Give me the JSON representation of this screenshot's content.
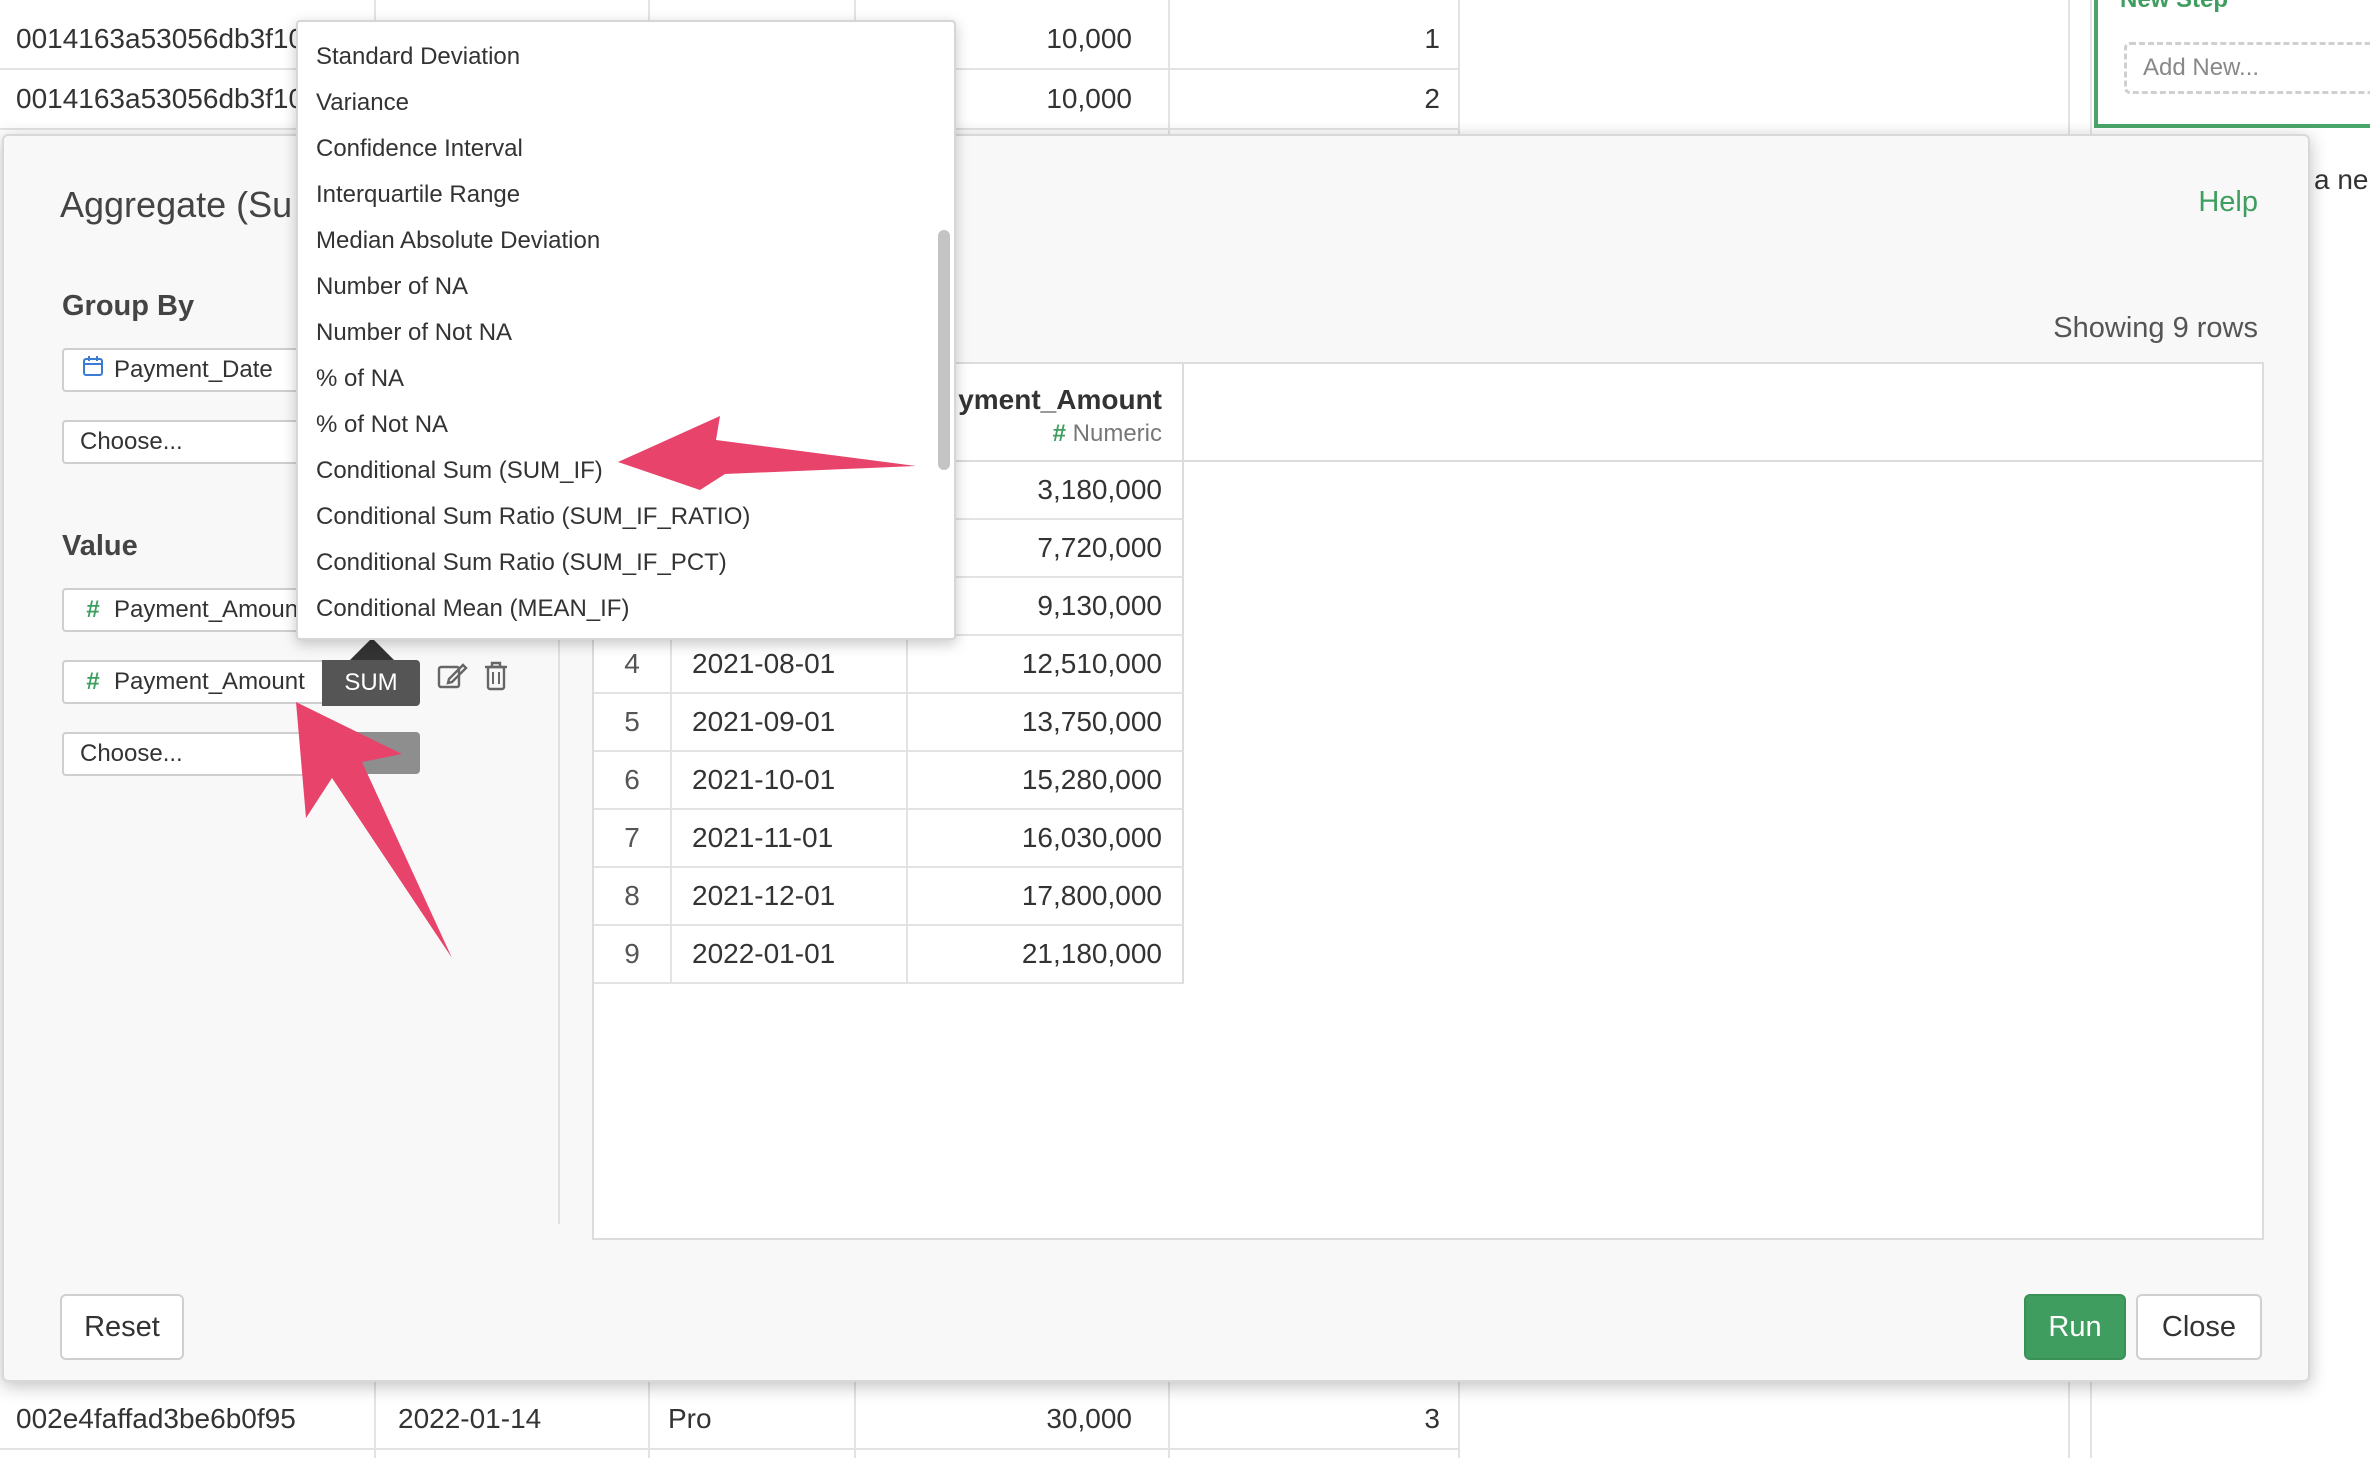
{
  "background_table": {
    "rows": [
      {
        "id": "0014163a53056db3f10",
        "date": "",
        "plan": "",
        "amount": "10,000",
        "count": "1"
      },
      {
        "id": "0014163a53056db3f10",
        "date": "",
        "plan": "",
        "amount": "10,000",
        "count": "2"
      },
      {
        "id": "002e4faffad3be6b0f95",
        "date": "2022-01-14",
        "plan": "Pro",
        "amount": "30,000",
        "count": "3"
      }
    ]
  },
  "side_panel": {
    "new_step_title": "New Step",
    "add_new_placeholder": "Add New...",
    "partial_text": "a ne"
  },
  "modal": {
    "title": "Aggregate (Su",
    "help_label": "Help",
    "group_by_label": "Group By",
    "group_by_field": "Payment_Date",
    "group_by_choose": "Choose...",
    "value_label": "Value",
    "value_field_1": "Payment_Amount",
    "value_field_2": "Payment_Amount",
    "value_func": "SUM",
    "value_choose": "Choose...",
    "showing_rows": "Showing 9 rows",
    "reset_label": "Reset",
    "run_label": "Run",
    "close_label": "Close"
  },
  "result_table": {
    "column_name": "yment_Amount",
    "column_type": "Numeric",
    "visible_values_top": [
      "3,180,000",
      "7,720,000",
      "9,130,000"
    ],
    "rows": [
      {
        "num": "4",
        "date": "2021-08-01",
        "value": "12,510,000"
      },
      {
        "num": "5",
        "date": "2021-09-01",
        "value": "13,750,000"
      },
      {
        "num": "6",
        "date": "2021-10-01",
        "value": "15,280,000"
      },
      {
        "num": "7",
        "date": "2021-11-01",
        "value": "16,030,000"
      },
      {
        "num": "8",
        "date": "2021-12-01",
        "value": "17,800,000"
      },
      {
        "num": "9",
        "date": "2022-01-01",
        "value": "21,180,000"
      }
    ]
  },
  "dropdown": {
    "items": [
      "Standard Deviation",
      "Variance",
      "Confidence Interval",
      "Interquartile Range",
      "Median Absolute Deviation",
      "Number of NA",
      "Number of Not NA",
      "% of NA",
      "% of Not NA",
      "Conditional Sum (SUM_IF)",
      "Conditional Sum Ratio (SUM_IF_RATIO)",
      "Conditional Sum Ratio (SUM_IF_PCT)",
      "Conditional Mean (MEAN_IF)"
    ]
  },
  "colors": {
    "accent_green": "#3f9e5f",
    "annotation_arrow": "#e8436a"
  }
}
